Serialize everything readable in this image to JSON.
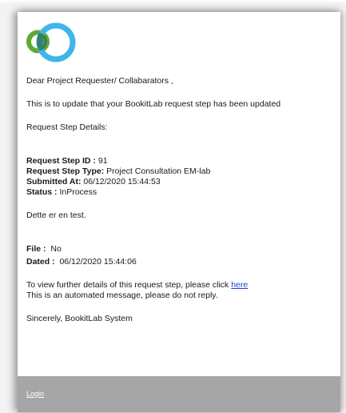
{
  "email": {
    "greeting": "Dear Project Requester/ Collabarators ,",
    "intro": "This is to update that your BookitLab request step has been updated",
    "details_heading": "Request Step Details:",
    "fields": {
      "request_step_id": {
        "label": "Request Step ID :",
        "value": "91"
      },
      "request_step_type": {
        "label": "Request Step Type:",
        "value": "Project Consultation EM-lab"
      },
      "submitted_at": {
        "label": "Submitted At:",
        "value": "06/12/2020 15:44:53"
      },
      "status": {
        "label": "Status :",
        "value": "InProcess"
      }
    },
    "comment": "Dette er en test.",
    "file": {
      "label": "File :",
      "value": "No"
    },
    "dated": {
      "label": "Dated :",
      "value": "06/12/2020 15:44:06"
    },
    "view_details_text": "To view further details of this request step, please click",
    "view_details_link": "here",
    "automated_notice": "This is an automated message, please do not reply.",
    "signoff": "Sincerely, BookitLab System"
  },
  "footer": {
    "login_link": "Login"
  },
  "colors": {
    "logo_green": "#5fa832",
    "logo_blue": "#3fb5ea",
    "logo_overlap": "#2c7a55",
    "link_blue": "#1f3fd1",
    "footer_gray": "#a6a6a6"
  },
  "icons": {
    "logo": "bookitlab-logo-icon"
  }
}
